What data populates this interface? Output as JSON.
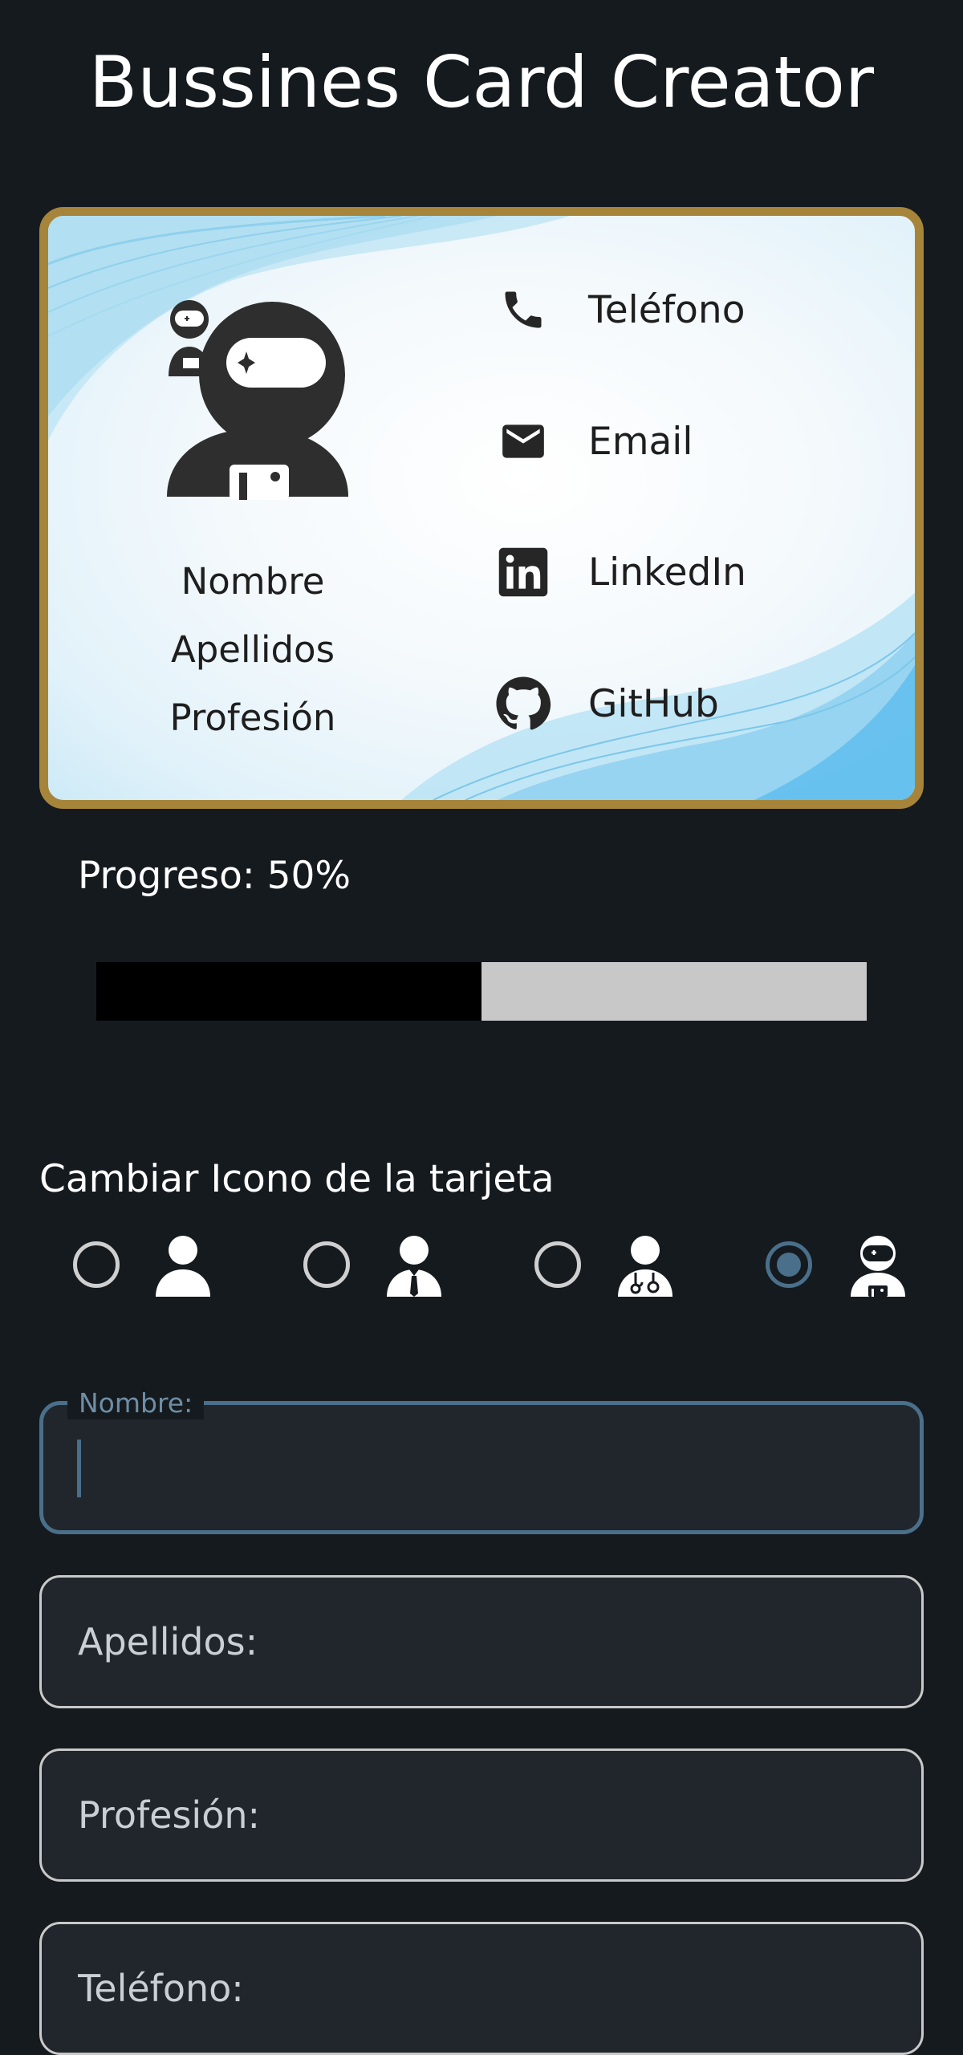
{
  "app": {
    "title": "Bussines Card Creator"
  },
  "card": {
    "name": "Nombre",
    "surname": "Apellidos",
    "profession": "Profesión",
    "border_color": "#a6843a",
    "avatar_icon": "astronaut-icon",
    "contacts": [
      {
        "icon": "phone-icon",
        "label": "Teléfono"
      },
      {
        "icon": "email-icon",
        "label": "Email"
      },
      {
        "icon": "linkedin-icon",
        "label": "LinkedIn"
      },
      {
        "icon": "github-icon",
        "label": "GitHub"
      }
    ]
  },
  "progress": {
    "label": "Progreso: 50%",
    "value": 0.5
  },
  "icon_chooser": {
    "title": "Cambiar Icono de la tarjeta",
    "accent": "#4a6f8a",
    "options": [
      {
        "icon": "person-icon",
        "checked": false
      },
      {
        "icon": "businessman-icon",
        "checked": false
      },
      {
        "icon": "doctor-icon",
        "checked": false
      },
      {
        "icon": "astronaut-icon",
        "checked": true
      }
    ]
  },
  "form": {
    "name_label": "Nombre:",
    "name_value": "",
    "surname_placeholder": "Apellidos:",
    "profession_placeholder": "Profesión:",
    "phone_placeholder": "Teléfono:"
  }
}
